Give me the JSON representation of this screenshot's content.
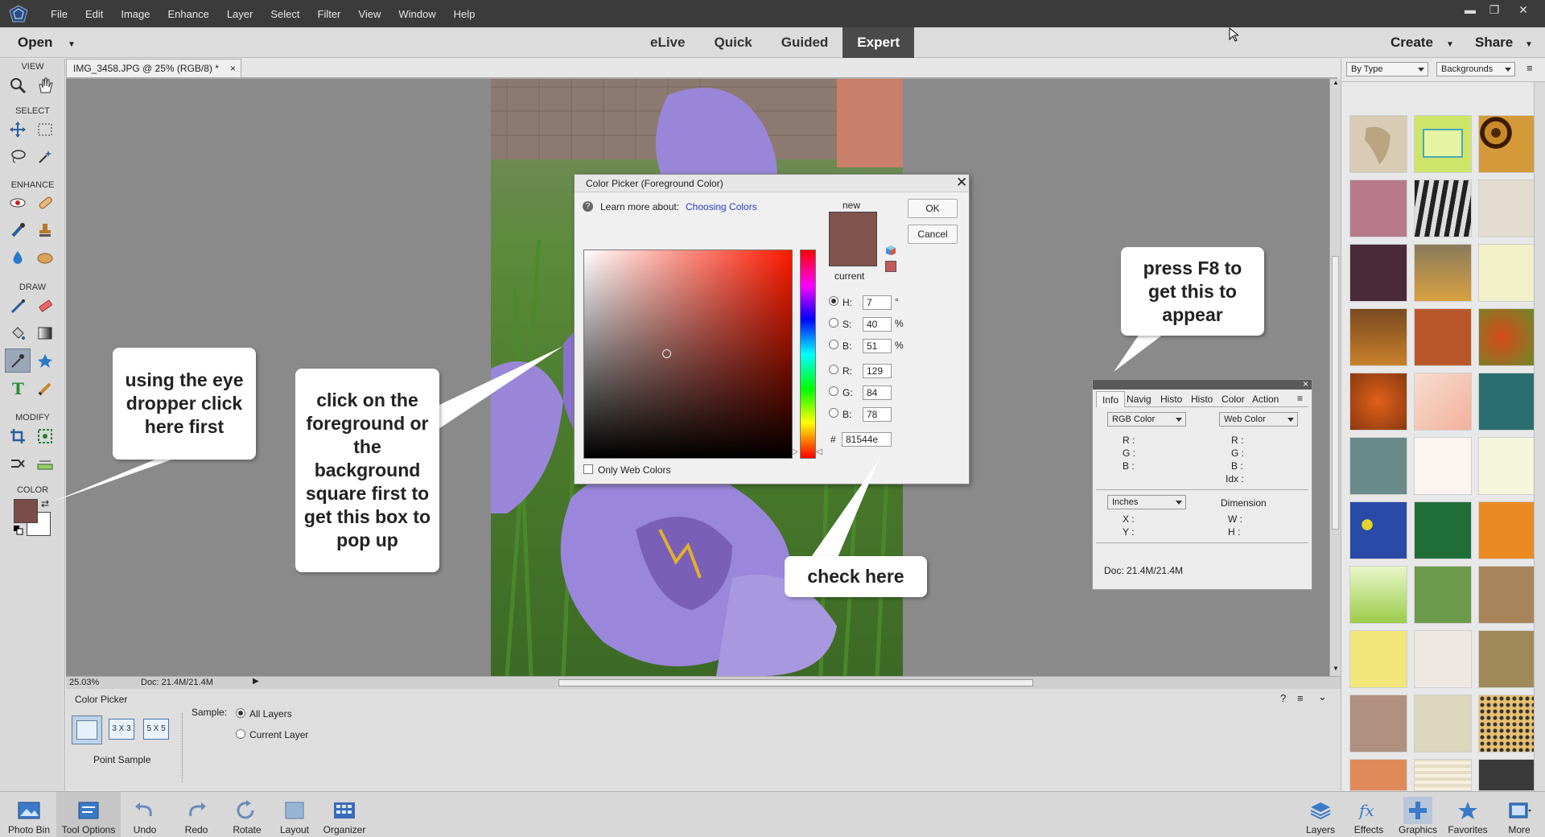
{
  "menu": [
    "File",
    "Edit",
    "Image",
    "Enhance",
    "Layer",
    "Select",
    "Filter",
    "View",
    "Window",
    "Help"
  ],
  "modebar": {
    "open": "Open",
    "modes": [
      "eLive",
      "Quick",
      "Guided",
      "Expert"
    ],
    "active": "Expert",
    "create": "Create",
    "share": "Share"
  },
  "toolbox": {
    "view": "VIEW",
    "select": "SELECT",
    "enhance": "ENHANCE",
    "draw": "DRAW",
    "modify": "MODIFY",
    "color": "COLOR",
    "fg_color": "#7b4d48"
  },
  "document": {
    "tab": "IMG_3458.JPG @ 25% (RGB/8) *",
    "zoom": "25.03%",
    "doc": "Doc: 21.4M/21.4M"
  },
  "tool_options": {
    "title": "Color Picker",
    "sizes": [
      "3 X 3",
      "5 X 5"
    ],
    "point_sample": "Point Sample",
    "sample_label": "Sample:",
    "all_layers": "All Layers",
    "current_layer": "Current Layer"
  },
  "color_picker": {
    "title": "Color Picker (Foreground Color)",
    "learn": "Learn more about:",
    "learn_link": "Choosing Colors",
    "new_label": "new",
    "current_label": "current",
    "ok": "OK",
    "cancel": "Cancel",
    "h_label": "H:",
    "h": "7",
    "h_unit": "°",
    "s_label": "S:",
    "s": "40",
    "s_unit": "%",
    "b_label": "B:",
    "b": "51",
    "b_unit": "%",
    "r_label": "R:",
    "r": "129",
    "g_label": "G:",
    "g": "84",
    "bl_label": "B:",
    "bl": "78",
    "hash": "#",
    "hex": "81544e",
    "only_web": "Only Web Colors",
    "swatch": "#81544e"
  },
  "info_panel": {
    "tabs": [
      "Info",
      "Navig",
      "Histo",
      "Histo",
      "Color",
      "Action"
    ],
    "mode1": "RGB Color",
    "mode2": "Web Color",
    "r": "R :",
    "g": "G :",
    "b": "B :",
    "r2": "R :",
    "g2": "G :",
    "b2": "B :",
    "idx": "Idx :",
    "units": "Inches",
    "dimension": "Dimension",
    "x": "X :",
    "y": "Y :",
    "w": "W :",
    "h": "H :",
    "doc": "Doc: 21.4M/21.4M"
  },
  "right_panel": {
    "by_type": "By Type",
    "backgrounds": "Backgrounds"
  },
  "callouts": {
    "eyedropper": "using the eye dropper click here first",
    "foreground": "click on the foreground or the background square first to get this box to pop up",
    "check": "check here",
    "f8": "press F8 to get this to appear"
  },
  "bottombar": {
    "photo_bin": "Photo Bin",
    "tool_options": "Tool Options",
    "undo": "Undo",
    "redo": "Redo",
    "rotate": "Rotate",
    "layout": "Layout",
    "organizer": "Organizer",
    "layers": "Layers",
    "effects": "Effects",
    "graphics": "Graphics",
    "favorites": "Favorites",
    "more": "More"
  }
}
